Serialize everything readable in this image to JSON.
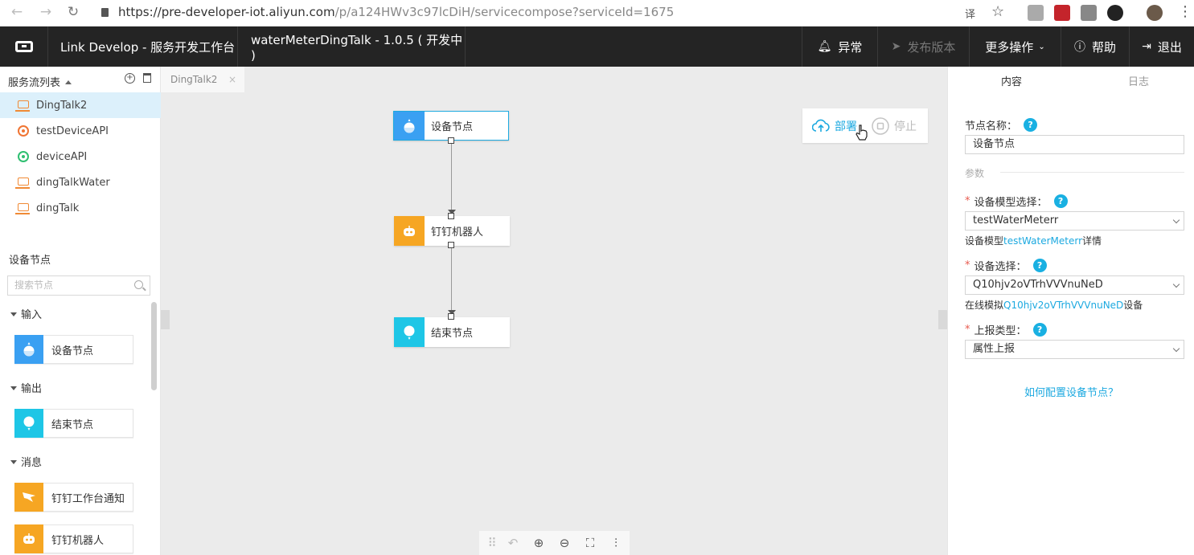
{
  "browser": {
    "back_label": "←",
    "forward_label": "→",
    "reload_label": "↻",
    "url_host": "https://pre-developer-iot.aliyun.com",
    "url_path": "/p/a124HWv3c97lcDiH/servicecompose?serviceId=1675",
    "star_label": "☆",
    "menu_label": "⋮",
    "translate_label": "译"
  },
  "header": {
    "brand": "Link Develop - 服务开发工作台",
    "project": "waterMeterDingTalk - 1.0.5 ( 开发中 )",
    "alert_label": "异常",
    "publish_label": "发布版本",
    "more_label": "更多操作",
    "help_label": "帮助",
    "logout_label": "退出"
  },
  "sidebar": {
    "list_title": "服务流列表",
    "flows": [
      {
        "label": "DingTalk2",
        "icon": "computer-icon"
      },
      {
        "label": "testDeviceAPI",
        "icon": "api-orange-icon"
      },
      {
        "label": "deviceAPI",
        "icon": "api-green-icon"
      },
      {
        "label": "dingTalkWater",
        "icon": "computer-icon"
      },
      {
        "label": "dingTalk",
        "icon": "computer-icon"
      }
    ],
    "node_section": "设备节点",
    "search_placeholder": "搜索节点",
    "groups": [
      {
        "label": "输入",
        "nodes": [
          {
            "label": "设备节点"
          }
        ]
      },
      {
        "label": "输出",
        "nodes": [
          {
            "label": "结束节点"
          }
        ]
      },
      {
        "label": "消息",
        "nodes": [
          {
            "label": "钉钉工作台通知"
          },
          {
            "label": "钉钉机器人"
          }
        ]
      }
    ]
  },
  "canvas": {
    "tab_label": "DingTalk2",
    "tab_close": "×",
    "nodes": [
      {
        "label": "设备节点"
      },
      {
        "label": "钉钉机器人"
      },
      {
        "label": "结束节点"
      }
    ],
    "deploy_label": "部署",
    "stop_label": "停止"
  },
  "right_panel": {
    "tab_content": "内容",
    "tab_log": "日志",
    "node_name_label": "节点名称：",
    "node_name_value": "设备节点",
    "params_label": "参数",
    "model_label": "设备模型选择：",
    "model_value": "testWaterMeterr",
    "model_hint_prefix": "设备模型",
    "model_hint_link": "testWaterMeterr",
    "model_hint_suffix": "详情",
    "device_label": "设备选择：",
    "device_value": "Q10hjv2oVTrhVVVnuNeD",
    "device_hint_prefix": "在线模拟",
    "device_hint_link": "Q10hjv2oVTrhVVVnuNeD",
    "device_hint_suffix": "设备",
    "report_label": "上报类型：",
    "report_value": "属性上报",
    "help_link": "如何配置设备节点？"
  },
  "colors": {
    "accent": "#1ca9e0",
    "header_bg": "#242424",
    "device_node": "#3aa0f2",
    "robot_node": "#f6a623",
    "end_node": "#1ec6e6",
    "active_row": "#dcf0fb"
  }
}
